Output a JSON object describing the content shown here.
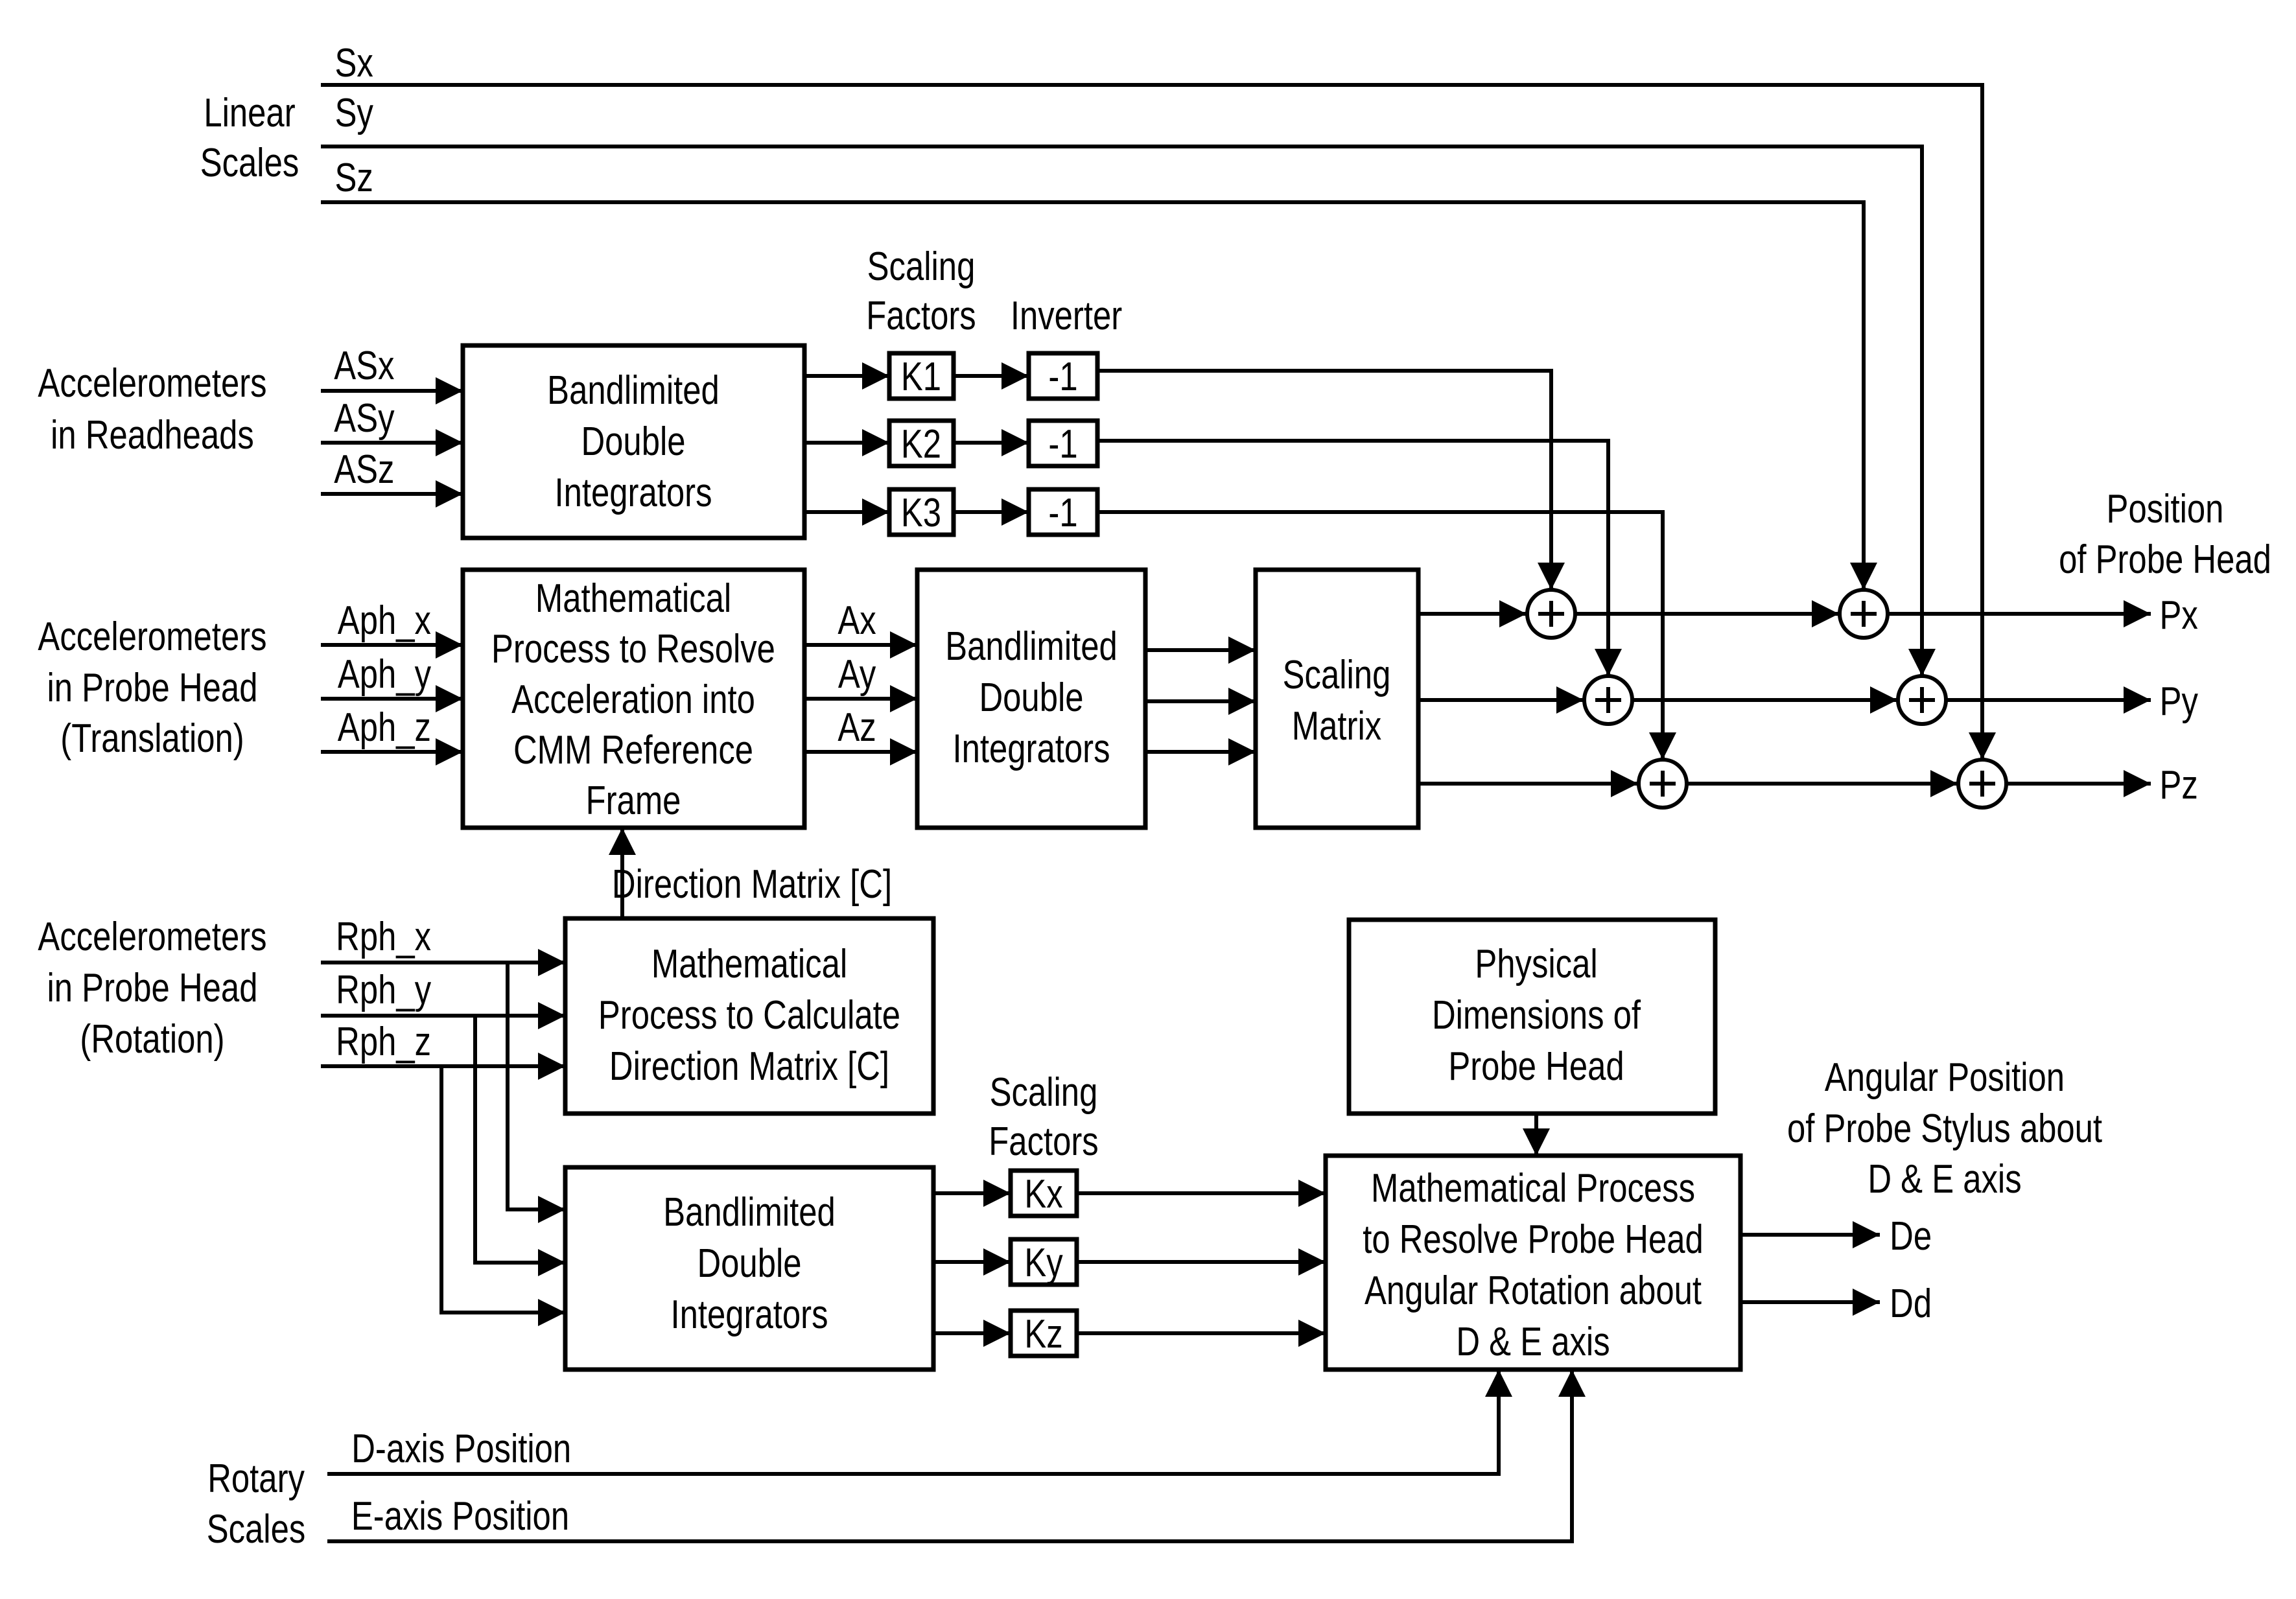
{
  "colors": {
    "ink": "#000000",
    "background": "#ffffff"
  },
  "inputs": {
    "linear_scales": {
      "group_label": [
        "Linear",
        "Scales"
      ],
      "signals": [
        "Sx",
        "Sy",
        "Sz"
      ]
    },
    "readhead_accel": {
      "group_label": [
        "Accelerometers",
        "in Readheads"
      ],
      "signals": [
        "ASx",
        "ASy",
        "ASz"
      ]
    },
    "probe_translation_accel": {
      "group_label": [
        "Accelerometers",
        "in Probe Head",
        "(Translation)"
      ],
      "signals": [
        "Aph_x",
        "Aph_y",
        "Aph_z"
      ]
    },
    "probe_rotation_accel": {
      "group_label": [
        "Accelerometers",
        "in Probe Head",
        "(Rotation)"
      ],
      "signals": [
        "Rph_x",
        "Rph_y",
        "Rph_z"
      ]
    },
    "rotary_scales": {
      "group_label": [
        "Rotary",
        "Scales"
      ],
      "signals": [
        "D-axis Position",
        "E-axis Position"
      ]
    }
  },
  "blocks": {
    "bdi_readheads": {
      "lines": [
        "Bandlimited",
        "Double",
        "Integrators"
      ]
    },
    "scaling_factors_top": {
      "header": [
        "Scaling",
        "Factors"
      ],
      "items": [
        "K1",
        "K2",
        "K3"
      ]
    },
    "inverters": {
      "header": "Inverter",
      "items": [
        "-1",
        "-1",
        "-1"
      ]
    },
    "resolve_accel": {
      "lines": [
        "Mathematical",
        "Process to Resolve",
        "Acceleration into",
        "CMM Reference",
        "Frame"
      ]
    },
    "resolved_signals": [
      "Ax",
      "Ay",
      "Az"
    ],
    "bdi_probe": {
      "lines": [
        "Bandlimited",
        "Double",
        "Integrators"
      ]
    },
    "scaling_matrix": {
      "lines": [
        "Scaling",
        "Matrix"
      ]
    },
    "direction_matrix_label": "Direction Matrix [C]",
    "calc_direction": {
      "lines": [
        "Mathematical",
        "Process to Calculate",
        "Direction Matrix [C]"
      ]
    },
    "bdi_rotation": {
      "lines": [
        "Bandlimited",
        "Double",
        "Integrators"
      ]
    },
    "scaling_factors_bottom": {
      "header": [
        "Scaling",
        "Factors"
      ],
      "items": [
        "Kx",
        "Ky",
        "Kz"
      ]
    },
    "physical_dims": {
      "lines": [
        "Physical",
        "Dimensions of",
        "Probe Head"
      ]
    },
    "resolve_rotation": {
      "lines": [
        "Mathematical Process",
        "to Resolve Probe Head",
        "Angular Rotation about",
        "D & E axis"
      ]
    },
    "summing_junction_symbol": "+"
  },
  "outputs": {
    "position": {
      "header": [
        "Position",
        "of Probe Head"
      ],
      "signals": [
        "Px",
        "Py",
        "Pz"
      ]
    },
    "angular": {
      "header": [
        "Angular Position",
        "of Probe Stylus about",
        "D & E axis"
      ],
      "signals": [
        "De",
        "Dd"
      ]
    }
  }
}
